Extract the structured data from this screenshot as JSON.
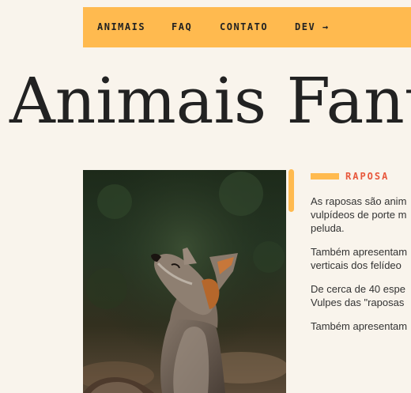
{
  "nav": {
    "items": [
      {
        "label": "ANIMAIS"
      },
      {
        "label": "FAQ"
      },
      {
        "label": "CONTATO"
      },
      {
        "label": "DEV →"
      }
    ]
  },
  "hero": {
    "title": "Animais Fant"
  },
  "article": {
    "photo_alt": "Raposa",
    "section_label": "RAPOSA",
    "paragraphs": [
      {
        "lines": [
          "As raposas são anim",
          "vulpídeos de porte m",
          "peluda."
        ]
      },
      {
        "lines": [
          "Também apresentam",
          "verticais dos felídeo"
        ]
      },
      {
        "lines": [
          "De cerca de 40 espe",
          "Vulpes das \"raposas"
        ]
      },
      {
        "lines": [
          "Também apresentam"
        ]
      }
    ]
  },
  "colors": {
    "background": "#f9f4ec",
    "accent": "#ffba4f",
    "label": "#e8573c",
    "text": "#333333"
  }
}
